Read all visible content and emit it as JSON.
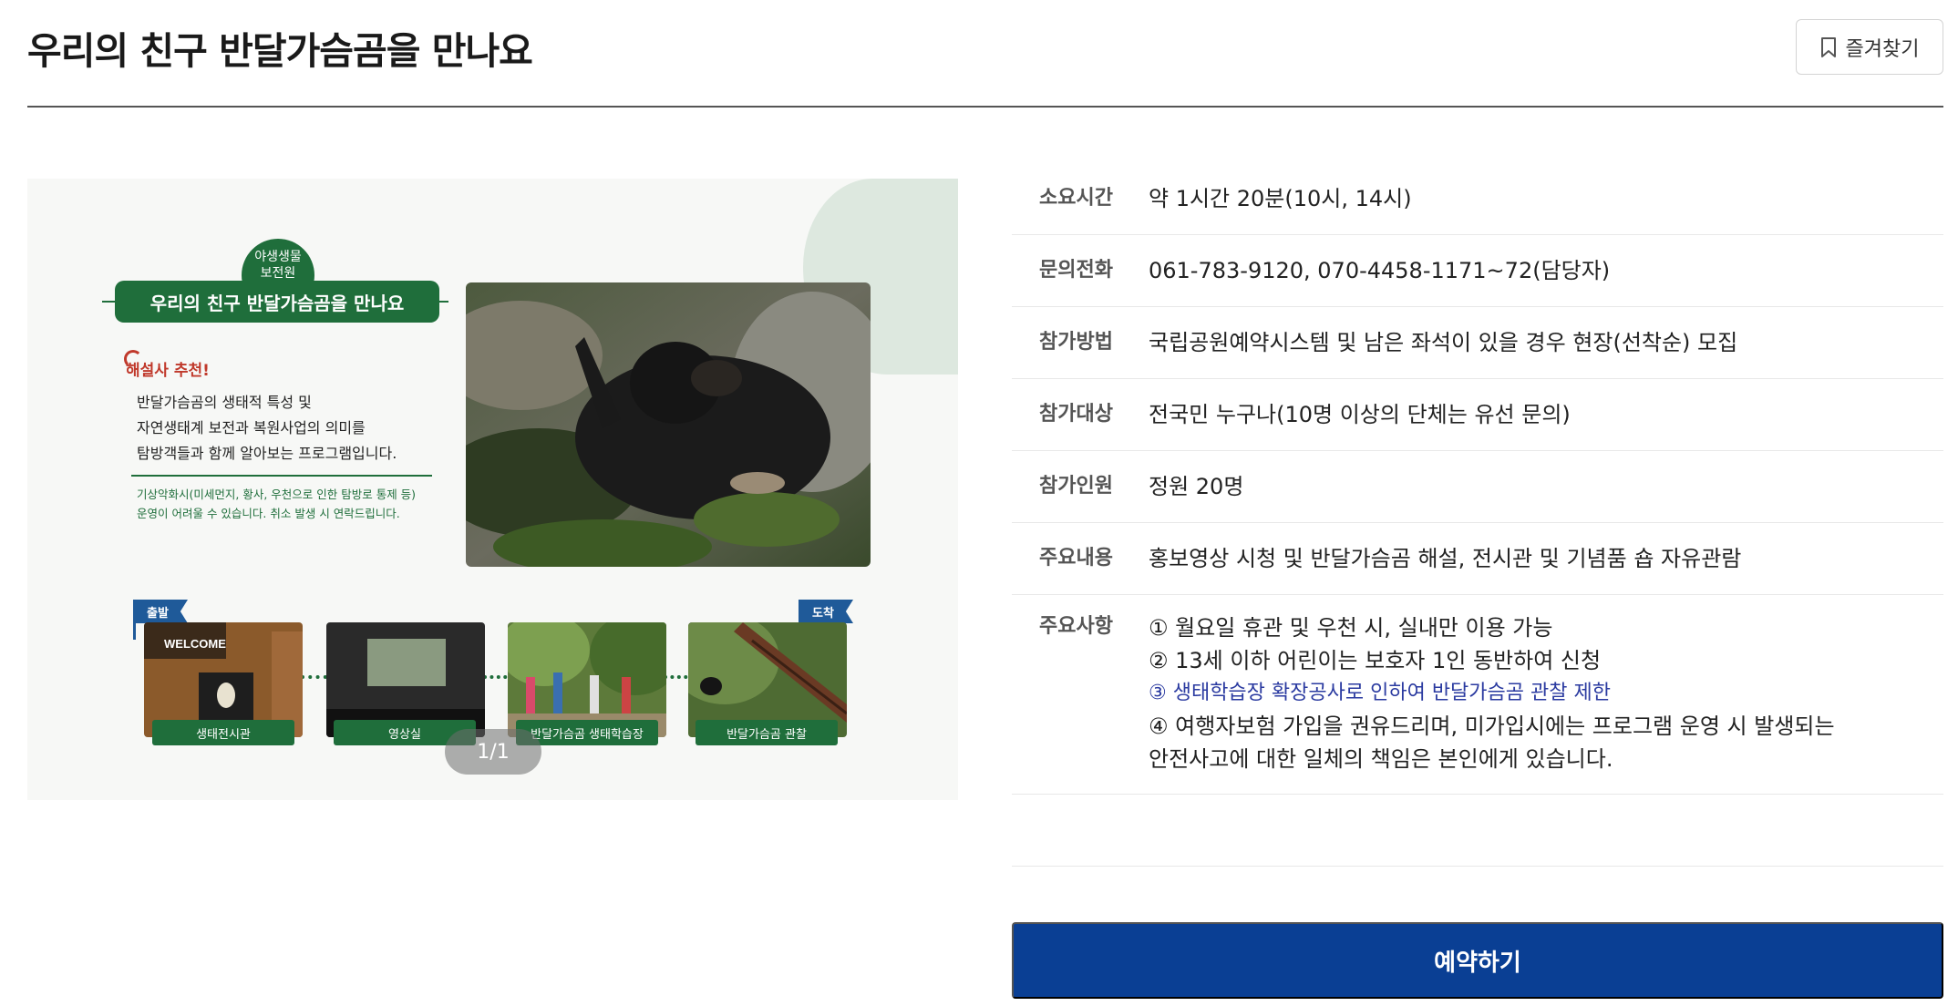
{
  "page": {
    "title": "우리의 친구 반달가슴곰을 만나요",
    "bookmark_label": "즐겨찾기"
  },
  "poster": {
    "badge_line1": "야생생물",
    "badge_line2": "보전원",
    "banner": "우리의 친구 반달가슴곰을 만나요",
    "recommend": "해설사 추천!",
    "desc_lines": [
      "반달가슴곰의 생태적 특성 및",
      "자연생태계 보전과 복원사업의 의미를",
      "탐방객들과 함께 알아보는 프로그램입니다."
    ],
    "note_lines": [
      "기상악화시(미세먼지, 황사, 우천으로 인한 탐방로 통제 등)",
      "운영이 어려울 수 있습니다. 취소 발생 시 연락드립니다."
    ],
    "flag_start": "출발",
    "flag_end": "도착",
    "welcome_sign": "WELCOME",
    "steps": [
      "생태전시관",
      "영상실",
      "반달가슴곰 생태학습장",
      "반달가슴곰 관찰"
    ],
    "pager": "1/1"
  },
  "info": {
    "rows": [
      {
        "key": "소요시간",
        "value": "약 1시간 20분(10시, 14시)"
      },
      {
        "key": "문의전화",
        "value": "061-783-9120, 070-4458-1171~72(담당자)"
      },
      {
        "key": "참가방법",
        "value": "국립공원예약시스템 및 남은 좌석이 있을 경우 현장(선착순) 모집"
      },
      {
        "key": "참가대상",
        "value": "전국민 누구나(10명 이상의 단체는 유선 문의)"
      },
      {
        "key": "참가인원",
        "value": "정원 20명"
      },
      {
        "key": "주요내용",
        "value": "홍보영상 시청 및 반달가슴곰 해설, 전시관 및 기념품 숍 자유관람"
      }
    ],
    "notes_key": "주요사항",
    "notes": [
      "① 월요일 휴관 및 우천 시, 실내만 이용 가능",
      "② 13세 이하 어린이는 보호자 1인 동반하여 신청",
      "③ 생태학습장 확장공사로 인하여 반달가슴곰 관찰 제한",
      "④ 여행자보험 가입을 권유드리며, 미가입시에는 프로그램 운영 시 발생되는",
      "안전사고에 대한 일체의 책임은 본인에게 있습니다."
    ]
  },
  "reserve_label": "예약하기",
  "colors": {
    "primary_button": "#0a3f94",
    "poster_green": "#1f6e3b",
    "notice_blue": "#2a3aa0"
  }
}
